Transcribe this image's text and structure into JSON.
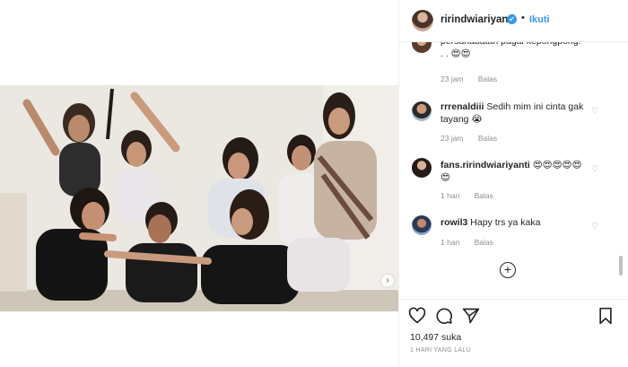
{
  "header": {
    "username": "ririndwiariyanti",
    "verified_mark": "✔",
    "separator": "•",
    "follow_label": "Ikuti"
  },
  "comments": [
    {
      "user": "",
      "text": "persahabatan pagai kepongpong. . . 😍😍",
      "time": "23 jam",
      "reply": "Balas"
    },
    {
      "user": "rrrenaldiii",
      "text": "Sedih mim ini cinta gak tayang 😭",
      "time": "23 jam",
      "reply": "Balas"
    },
    {
      "user": "fans.ririndwiariyanti",
      "text": "😍😍😍😍😍 😍",
      "time": "1 hari",
      "reply": "Balas"
    },
    {
      "user": "rowil3",
      "text": "Hapy trs ya kaka",
      "time": "1 hari",
      "reply": "Balas"
    }
  ],
  "load_more_icon": "plus-circle-icon",
  "actions": {
    "like_icon": "heart-icon",
    "comment_icon": "comment-icon",
    "share_icon": "share-icon",
    "save_icon": "bookmark-icon",
    "likes": "10,497 suka",
    "time_ago": "1 HARI YANG LALU"
  },
  "media": {
    "next_icon": "chevron-right-icon",
    "next_glyph": "›"
  },
  "colors": {
    "accent": "#3897f0",
    "text": "#262626",
    "muted": "#8e8e8e",
    "border": "#efefef"
  }
}
